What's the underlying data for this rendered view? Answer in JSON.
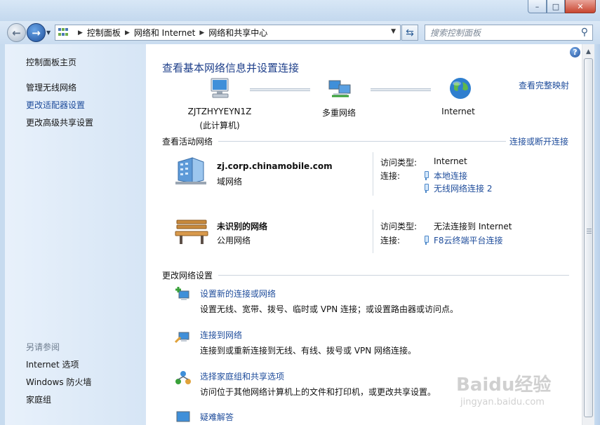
{
  "window": {
    "buttons": {
      "minimize": "–",
      "maximize": "□",
      "close": "✕"
    }
  },
  "nav": {
    "back_icon": "back-arrow-icon",
    "forward_icon": "forward-arrow-icon",
    "breadcrumb": [
      "控制面板",
      "网络和 Internet",
      "网络和共享中心"
    ],
    "search_placeholder": "搜索控制面板"
  },
  "sidebar": {
    "home": "控制面板主页",
    "links": [
      "管理无线网络",
      "更改适配器设置",
      "更改高级共享设置"
    ],
    "see_also_header": "另请参阅",
    "see_also": [
      "Internet 选项",
      "Windows 防火墙",
      "家庭组"
    ]
  },
  "main": {
    "title": "查看基本网络信息并设置连接",
    "full_map_link": "查看完整映射",
    "map": {
      "computer_name": "ZJTZHYYEYN1Z",
      "computer_sub": "(此计算机)",
      "network": "多重网络",
      "internet": "Internet"
    },
    "active_header": "查看活动网络",
    "connect_link": "连接或断开连接",
    "networks": [
      {
        "name": "zj.corp.chinamobile.com",
        "type": "域网络",
        "access_label": "访问类型:",
        "access_value": "Internet",
        "conn_label": "连接:",
        "connections": [
          "本地连接",
          "无线网络连接 2"
        ]
      },
      {
        "name": "未识别的网络",
        "type": "公用网络",
        "access_label": "访问类型:",
        "access_value": "无法连接到 Internet",
        "conn_label": "连接:",
        "connections": [
          "F8云终端平台连接"
        ]
      }
    ],
    "settings_header": "更改网络设置",
    "tasks": [
      {
        "title": "设置新的连接或网络",
        "desc": "设置无线、宽带、拨号、临时或 VPN 连接；或设置路由器或访问点。"
      },
      {
        "title": "连接到网络",
        "desc": "连接到或重新连接到无线、有线、拨号或 VPN 网络连接。"
      },
      {
        "title": "选择家庭组和共享选项",
        "desc": "访问位于其他网络计算机上的文件和打印机，或更改共享设置。"
      },
      {
        "title": "疑难解答",
        "desc": ""
      }
    ]
  },
  "watermark": {
    "brand": "Baidu经验",
    "url": "jingyan.baidu.com"
  }
}
